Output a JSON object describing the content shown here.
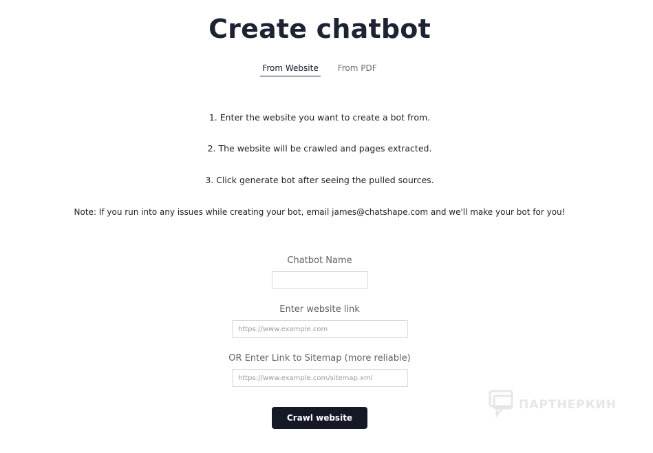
{
  "page": {
    "title": "Create chatbot"
  },
  "tabs": [
    {
      "label": "From Website",
      "active": true
    },
    {
      "label": "From PDF",
      "active": false
    }
  ],
  "instructions": {
    "step1": "1. Enter the website you want to create a bot from.",
    "step2": "2. The website will be crawled and pages extracted.",
    "step3": "3. Click generate bot after seeing the pulled sources.",
    "note": "Note: If you run into any issues while creating your bot, email james@chatshape.com and we'll make your bot for you!"
  },
  "form": {
    "chatbot_name": {
      "label": "Chatbot Name",
      "value": "",
      "placeholder": ""
    },
    "website_link": {
      "label": "Enter website link",
      "value": "",
      "placeholder": "https://www.example.com"
    },
    "sitemap_link": {
      "label": "OR Enter Link to Sitemap (more reliable)",
      "value": "",
      "placeholder": "https://www.example.com/sitemap.xml"
    },
    "submit_label": "Crawl website"
  },
  "watermark": {
    "text": "ПАРТНЕРКИН",
    "icon": "chat-bubble-icon"
  },
  "colors": {
    "title": "#1c2434",
    "button_bg": "#141827",
    "button_text": "#ffffff",
    "label": "#5f6368",
    "input_border": "#d7d9de"
  }
}
